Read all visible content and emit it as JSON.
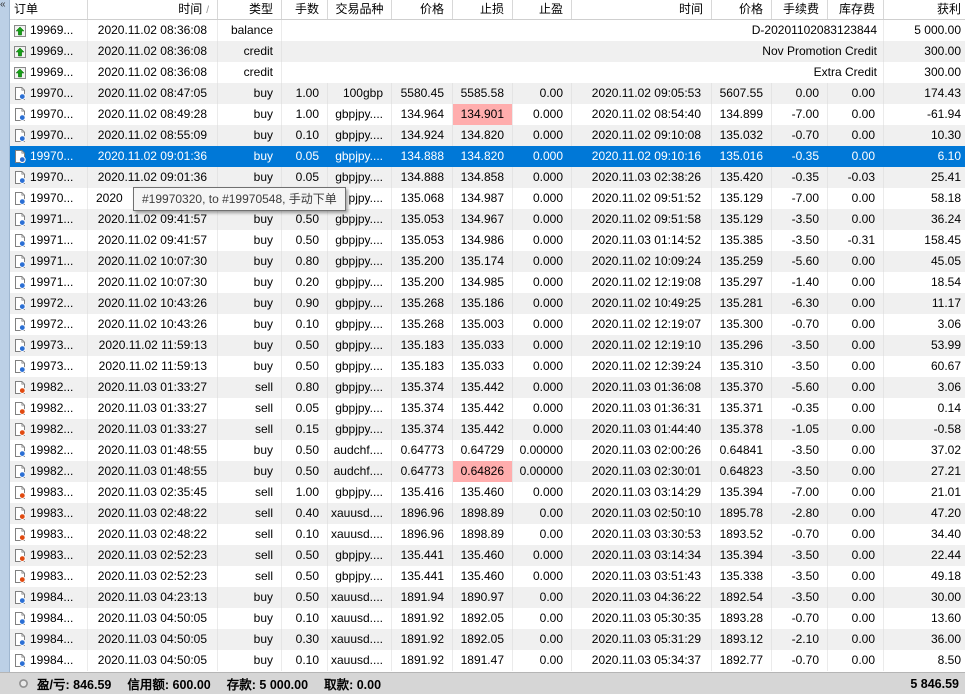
{
  "colors": {
    "selection_blue": "#0078d7",
    "sl_hit_pink": "#ffadad",
    "zebra_gray": "#f0f0f0",
    "statusbar_gray": "#d6d6d6",
    "deposit_green": "#18a018",
    "buy_dot_blue": "#2b6fd4",
    "sell_dot_red": "#e04a10"
  },
  "header": {
    "order": "订单",
    "time": "时间",
    "sort_indicator": "/",
    "type": "类型",
    "lots": "手数",
    "symbol": "交易品种",
    "price": "价格",
    "sl": "止损",
    "tp": "止盈",
    "time2": "时间",
    "price2": "价格",
    "commission": "手续费",
    "swap": "库存费",
    "profit": "获利"
  },
  "tooltip": {
    "text": "#19970320, to #19970548, 手动下单"
  },
  "rows": [
    {
      "icon": "deposit",
      "order": "19969...",
      "time": "2020.11.02 08:36:08",
      "type": "balance",
      "comment": "D-20201102083123844",
      "profit": "5 000.00"
    },
    {
      "icon": "deposit",
      "order": "19969...",
      "time": "2020.11.02 08:36:08",
      "type": "credit",
      "comment": "Nov Promotion Credit",
      "profit": "300.00"
    },
    {
      "icon": "deposit",
      "order": "19969...",
      "time": "2020.11.02 08:36:08",
      "type": "credit",
      "comment": "Extra Credit",
      "profit": "300.00"
    },
    {
      "icon": "buy",
      "order": "19970...",
      "time": "2020.11.02 08:47:05",
      "type": "buy",
      "lots": "1.00",
      "symbol": "100gbp",
      "price": "5580.45",
      "sl": "5585.58",
      "tp": "0.00",
      "time2": "2020.11.02 09:05:53",
      "price2": "5607.55",
      "comm": "0.00",
      "swap": "0.00",
      "profit": "174.43"
    },
    {
      "icon": "buy",
      "order": "19970...",
      "time": "2020.11.02 08:49:28",
      "type": "buy",
      "lots": "1.00",
      "symbol": "gbpjpy....",
      "price": "134.964",
      "sl": "134.901",
      "sl_hit": true,
      "tp": "0.000",
      "time2": "2020.11.02 08:54:40",
      "price2": "134.899",
      "comm": "-7.00",
      "swap": "0.00",
      "profit": "-61.94"
    },
    {
      "icon": "buy",
      "order": "19970...",
      "time": "2020.11.02 08:55:09",
      "type": "buy",
      "lots": "0.10",
      "symbol": "gbpjpy....",
      "price": "134.924",
      "sl": "134.820",
      "tp": "0.000",
      "time2": "2020.11.02 09:10:08",
      "price2": "135.032",
      "comm": "-0.70",
      "swap": "0.00",
      "profit": "10.30"
    },
    {
      "icon": "buy",
      "order": "19970...",
      "time": "2020.11.02 09:01:36",
      "type": "buy",
      "lots": "0.05",
      "symbol": "gbpjpy....",
      "price": "134.888",
      "sl": "134.820",
      "tp": "0.000",
      "time2": "2020.11.02 09:10:16",
      "price2": "135.016",
      "comm": "-0.35",
      "swap": "0.00",
      "profit": "6.10",
      "selected": true
    },
    {
      "icon": "buy",
      "order": "19970...",
      "time": "2020.11.02 09:01:36",
      "type": "buy",
      "lots": "0.05",
      "symbol": "gbpjpy....",
      "price": "134.888",
      "sl": "134.858",
      "tp": "0.000",
      "time2": "2020.11.03 02:38:26",
      "price2": "135.420",
      "comm": "-0.35",
      "swap": "-0.03",
      "profit": "25.41"
    },
    {
      "icon": "buy",
      "order": "19970...",
      "time": "2020",
      "type": "",
      "lots": "",
      "symbol": "pjpy....",
      "price": "135.068",
      "sl": "134.987",
      "tp": "0.000",
      "time2": "2020.11.02 09:51:52",
      "price2": "135.129",
      "comm": "-7.00",
      "swap": "0.00",
      "profit": "58.18",
      "covered": true
    },
    {
      "icon": "buy",
      "order": "19971...",
      "time": "2020.11.02 09:41:57",
      "type": "buy",
      "lots": "0.50",
      "symbol": "gbpjpy....",
      "price": "135.053",
      "sl": "134.967",
      "tp": "0.000",
      "time2": "2020.11.02 09:51:58",
      "price2": "135.129",
      "comm": "-3.50",
      "swap": "0.00",
      "profit": "36.24"
    },
    {
      "icon": "buy",
      "order": "19971...",
      "time": "2020.11.02 09:41:57",
      "type": "buy",
      "lots": "0.50",
      "symbol": "gbpjpy....",
      "price": "135.053",
      "sl": "134.986",
      "tp": "0.000",
      "time2": "2020.11.03 01:14:52",
      "price2": "135.385",
      "comm": "-3.50",
      "swap": "-0.31",
      "profit": "158.45"
    },
    {
      "icon": "buy",
      "order": "19971...",
      "time": "2020.11.02 10:07:30",
      "type": "buy",
      "lots": "0.80",
      "symbol": "gbpjpy....",
      "price": "135.200",
      "sl": "135.174",
      "tp": "0.000",
      "time2": "2020.11.02 10:09:24",
      "price2": "135.259",
      "comm": "-5.60",
      "swap": "0.00",
      "profit": "45.05"
    },
    {
      "icon": "buy",
      "order": "19971...",
      "time": "2020.11.02 10:07:30",
      "type": "buy",
      "lots": "0.20",
      "symbol": "gbpjpy....",
      "price": "135.200",
      "sl": "134.985",
      "tp": "0.000",
      "time2": "2020.11.02 12:19:08",
      "price2": "135.297",
      "comm": "-1.40",
      "swap": "0.00",
      "profit": "18.54"
    },
    {
      "icon": "buy",
      "order": "19972...",
      "time": "2020.11.02 10:43:26",
      "type": "buy",
      "lots": "0.90",
      "symbol": "gbpjpy....",
      "price": "135.268",
      "sl": "135.186",
      "tp": "0.000",
      "time2": "2020.11.02 10:49:25",
      "price2": "135.281",
      "comm": "-6.30",
      "swap": "0.00",
      "profit": "11.17"
    },
    {
      "icon": "buy",
      "order": "19972...",
      "time": "2020.11.02 10:43:26",
      "type": "buy",
      "lots": "0.10",
      "symbol": "gbpjpy....",
      "price": "135.268",
      "sl": "135.003",
      "tp": "0.000",
      "time2": "2020.11.02 12:19:07",
      "price2": "135.300",
      "comm": "-0.70",
      "swap": "0.00",
      "profit": "3.06"
    },
    {
      "icon": "buy",
      "order": "19973...",
      "time": "2020.11.02 11:59:13",
      "type": "buy",
      "lots": "0.50",
      "symbol": "gbpjpy....",
      "price": "135.183",
      "sl": "135.033",
      "tp": "0.000",
      "time2": "2020.11.02 12:19:10",
      "price2": "135.296",
      "comm": "-3.50",
      "swap": "0.00",
      "profit": "53.99"
    },
    {
      "icon": "buy",
      "order": "19973...",
      "time": "2020.11.02 11:59:13",
      "type": "buy",
      "lots": "0.50",
      "symbol": "gbpjpy....",
      "price": "135.183",
      "sl": "135.033",
      "tp": "0.000",
      "time2": "2020.11.02 12:39:24",
      "price2": "135.310",
      "comm": "-3.50",
      "swap": "0.00",
      "profit": "60.67"
    },
    {
      "icon": "sell",
      "order": "19982...",
      "time": "2020.11.03 01:33:27",
      "type": "sell",
      "lots": "0.80",
      "symbol": "gbpjpy....",
      "price": "135.374",
      "sl": "135.442",
      "tp": "0.000",
      "time2": "2020.11.03 01:36:08",
      "price2": "135.370",
      "comm": "-5.60",
      "swap": "0.00",
      "profit": "3.06"
    },
    {
      "icon": "sell",
      "order": "19982...",
      "time": "2020.11.03 01:33:27",
      "type": "sell",
      "lots": "0.05",
      "symbol": "gbpjpy....",
      "price": "135.374",
      "sl": "135.442",
      "tp": "0.000",
      "time2": "2020.11.03 01:36:31",
      "price2": "135.371",
      "comm": "-0.35",
      "swap": "0.00",
      "profit": "0.14"
    },
    {
      "icon": "sell",
      "order": "19982...",
      "time": "2020.11.03 01:33:27",
      "type": "sell",
      "lots": "0.15",
      "symbol": "gbpjpy....",
      "price": "135.374",
      "sl": "135.442",
      "tp": "0.000",
      "time2": "2020.11.03 01:44:40",
      "price2": "135.378",
      "comm": "-1.05",
      "swap": "0.00",
      "profit": "-0.58"
    },
    {
      "icon": "buy",
      "order": "19982...",
      "time": "2020.11.03 01:48:55",
      "type": "buy",
      "lots": "0.50",
      "symbol": "audchf....",
      "price": "0.64773",
      "sl": "0.64729",
      "tp": "0.00000",
      "time2": "2020.11.03 02:00:26",
      "price2": "0.64841",
      "comm": "-3.50",
      "swap": "0.00",
      "profit": "37.02"
    },
    {
      "icon": "buy",
      "order": "19982...",
      "time": "2020.11.03 01:48:55",
      "type": "buy",
      "lots": "0.50",
      "symbol": "audchf....",
      "price": "0.64773",
      "sl": "0.64826",
      "sl_hit": true,
      "tp": "0.00000",
      "time2": "2020.11.03 02:30:01",
      "price2": "0.64823",
      "comm": "-3.50",
      "swap": "0.00",
      "profit": "27.21"
    },
    {
      "icon": "sell",
      "order": "19983...",
      "time": "2020.11.03 02:35:45",
      "type": "sell",
      "lots": "1.00",
      "symbol": "gbpjpy....",
      "price": "135.416",
      "sl": "135.460",
      "tp": "0.000",
      "time2": "2020.11.03 03:14:29",
      "price2": "135.394",
      "comm": "-7.00",
      "swap": "0.00",
      "profit": "21.01"
    },
    {
      "icon": "sell",
      "order": "19983...",
      "time": "2020.11.03 02:48:22",
      "type": "sell",
      "lots": "0.40",
      "symbol": "xauusd....",
      "price": "1896.96",
      "sl": "1898.89",
      "tp": "0.00",
      "time2": "2020.11.03 02:50:10",
      "price2": "1895.78",
      "comm": "-2.80",
      "swap": "0.00",
      "profit": "47.20"
    },
    {
      "icon": "sell",
      "order": "19983...",
      "time": "2020.11.03 02:48:22",
      "type": "sell",
      "lots": "0.10",
      "symbol": "xauusd....",
      "price": "1896.96",
      "sl": "1898.89",
      "tp": "0.00",
      "time2": "2020.11.03 03:30:53",
      "price2": "1893.52",
      "comm": "-0.70",
      "swap": "0.00",
      "profit": "34.40"
    },
    {
      "icon": "sell",
      "order": "19983...",
      "time": "2020.11.03 02:52:23",
      "type": "sell",
      "lots": "0.50",
      "symbol": "gbpjpy....",
      "price": "135.441",
      "sl": "135.460",
      "tp": "0.000",
      "time2": "2020.11.03 03:14:34",
      "price2": "135.394",
      "comm": "-3.50",
      "swap": "0.00",
      "profit": "22.44"
    },
    {
      "icon": "sell",
      "order": "19983...",
      "time": "2020.11.03 02:52:23",
      "type": "sell",
      "lots": "0.50",
      "symbol": "gbpjpy....",
      "price": "135.441",
      "sl": "135.460",
      "tp": "0.000",
      "time2": "2020.11.03 03:51:43",
      "price2": "135.338",
      "comm": "-3.50",
      "swap": "0.00",
      "profit": "49.18"
    },
    {
      "icon": "buy",
      "order": "19984...",
      "time": "2020.11.03 04:23:13",
      "type": "buy",
      "lots": "0.50",
      "symbol": "xauusd....",
      "price": "1891.94",
      "sl": "1890.97",
      "tp": "0.00",
      "time2": "2020.11.03 04:36:22",
      "price2": "1892.54",
      "comm": "-3.50",
      "swap": "0.00",
      "profit": "30.00"
    },
    {
      "icon": "buy",
      "order": "19984...",
      "time": "2020.11.03 04:50:05",
      "type": "buy",
      "lots": "0.10",
      "symbol": "xauusd....",
      "price": "1891.92",
      "sl": "1892.05",
      "tp": "0.00",
      "time2": "2020.11.03 05:30:35",
      "price2": "1893.28",
      "comm": "-0.70",
      "swap": "0.00",
      "profit": "13.60"
    },
    {
      "icon": "buy",
      "order": "19984...",
      "time": "2020.11.03 04:50:05",
      "type": "buy",
      "lots": "0.30",
      "symbol": "xauusd....",
      "price": "1891.92",
      "sl": "1892.05",
      "tp": "0.00",
      "time2": "2020.11.03 05:31:29",
      "price2": "1893.12",
      "comm": "-2.10",
      "swap": "0.00",
      "profit": "36.00"
    },
    {
      "icon": "buy",
      "order": "19984...",
      "time": "2020.11.03 04:50:05",
      "type": "buy",
      "lots": "0.10",
      "symbol": "xauusd....",
      "price": "1891.92",
      "sl": "1891.47",
      "tp": "0.00",
      "time2": "2020.11.03 05:34:37",
      "price2": "1892.77",
      "comm": "-0.70",
      "swap": "0.00",
      "profit": "8.50"
    }
  ],
  "status_bar": {
    "profit_loss_label": "盈/亏:",
    "profit_loss": "846.59",
    "credit_label": "信用额:",
    "credit": "600.00",
    "deposit_label": "存款:",
    "deposit": "5 000.00",
    "withdrawal_label": "取款:",
    "withdrawal": "0.00",
    "total": "5 846.59"
  }
}
